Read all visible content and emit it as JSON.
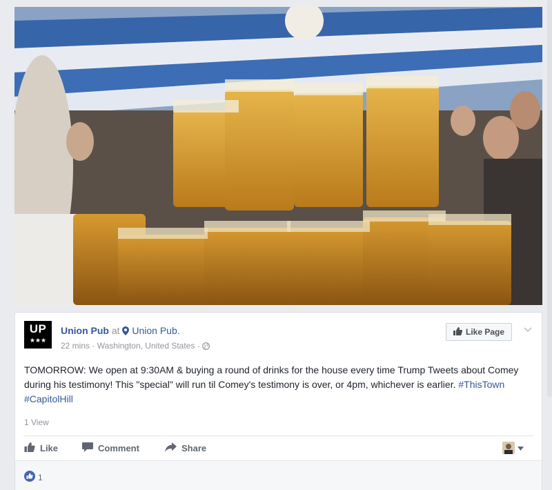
{
  "video": {
    "description_icon": "video-thumbnail"
  },
  "post": {
    "page_logo": {
      "line1": "UP",
      "line2": "★★★"
    },
    "page_name": "Union Pub",
    "at_text": "at",
    "place_name": "Union Pub.",
    "time": "22 mins",
    "separator": "·",
    "location": "Washington, United States",
    "separator2": "·",
    "like_page_label": "Like Page",
    "text_main": "TOMORROW: We open at 9:30AM & buying a round of drinks for the house every time Trump Tweets about Comey during his testimony! This \"special\" will run til Comey's testimony is over, or 4pm, whichever is earlier.",
    "hashtag1": "#ThisTown",
    "hashtag2": "#CapitolHill",
    "views": "1 View",
    "actions": {
      "like": "Like",
      "comment": "Comment",
      "share": "Share"
    },
    "reactions_count": "1"
  },
  "colors": {
    "link": "#365899",
    "like_blue": "#4267b2",
    "meta": "#90949c"
  }
}
